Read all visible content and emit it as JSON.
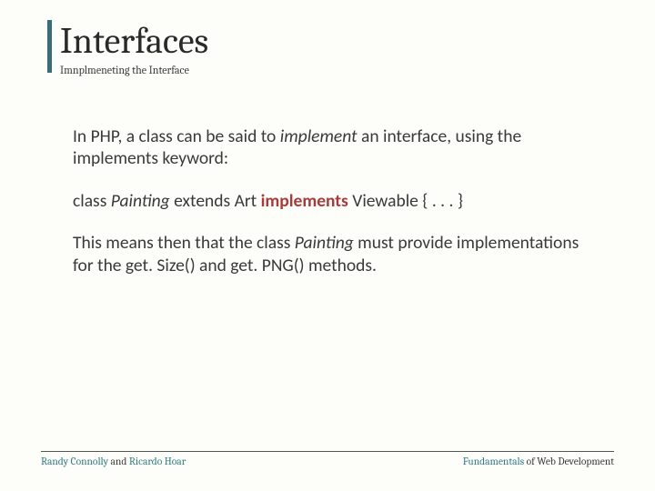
{
  "header": {
    "title": "Interfaces",
    "subtitle": "Imnplmeneting the Interface"
  },
  "body": {
    "p1a": "In PHP, a class can be said to ",
    "p1b": "implement",
    "p1c": " an interface, using the implements keyword:",
    "code_a": "class ",
    "code_b": "Painting",
    "code_c": " extends Art ",
    "code_d": "implements",
    "code_e": " Viewable { . . . }",
    "p2a": "This means then that the class ",
    "p2b": "Painting",
    "p2c": " must provide implementations for the get. Size() and get. PNG() methods."
  },
  "footer": {
    "left_a": "Randy Connolly ",
    "left_b": "and",
    "left_c": " Ricardo Hoar",
    "right_a": "Fundamentals ",
    "right_b": "of Web Development"
  }
}
